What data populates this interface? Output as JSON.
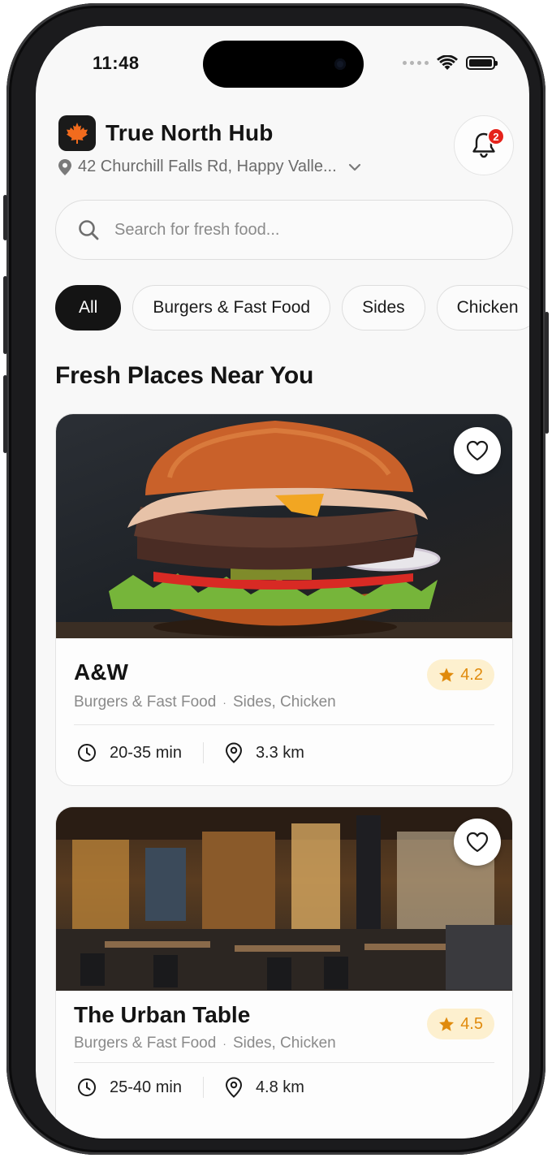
{
  "status_bar": {
    "time": "11:48"
  },
  "header": {
    "app_name": "True North Hub",
    "location": "42 Churchill Falls Rd, Happy Valle...",
    "notification_count": "2"
  },
  "search": {
    "placeholder": "Search for fresh food..."
  },
  "categories": [
    "All",
    "Burgers & Fast Food",
    "Sides",
    "Chicken"
  ],
  "selected_category": "All",
  "section_title": "Fresh Places Near You",
  "restaurants": [
    {
      "name": "A&W",
      "rating": "4.2",
      "category": "Burgers & Fast Food",
      "tags": "Sides, Chicken",
      "time": "20-35 min",
      "distance": "3.3 km"
    },
    {
      "name": "The Urban Table",
      "rating": "4.5",
      "category": "Burgers & Fast Food",
      "tags": "Sides, Chicken",
      "time": "25-40 min",
      "distance": "4.8 km"
    }
  ],
  "colors": {
    "accent_dark": "#141414",
    "badge_red": "#e5231b",
    "rating_bg": "#fdf0cf",
    "rating_text": "#e08a0c",
    "muted_text": "#8a8a8a"
  },
  "icons": [
    "maple-leaf-icon",
    "location-pin-icon",
    "chevron-down-icon",
    "bell-icon",
    "search-icon",
    "heart-icon",
    "star-icon",
    "clock-icon",
    "map-pin-icon"
  ]
}
